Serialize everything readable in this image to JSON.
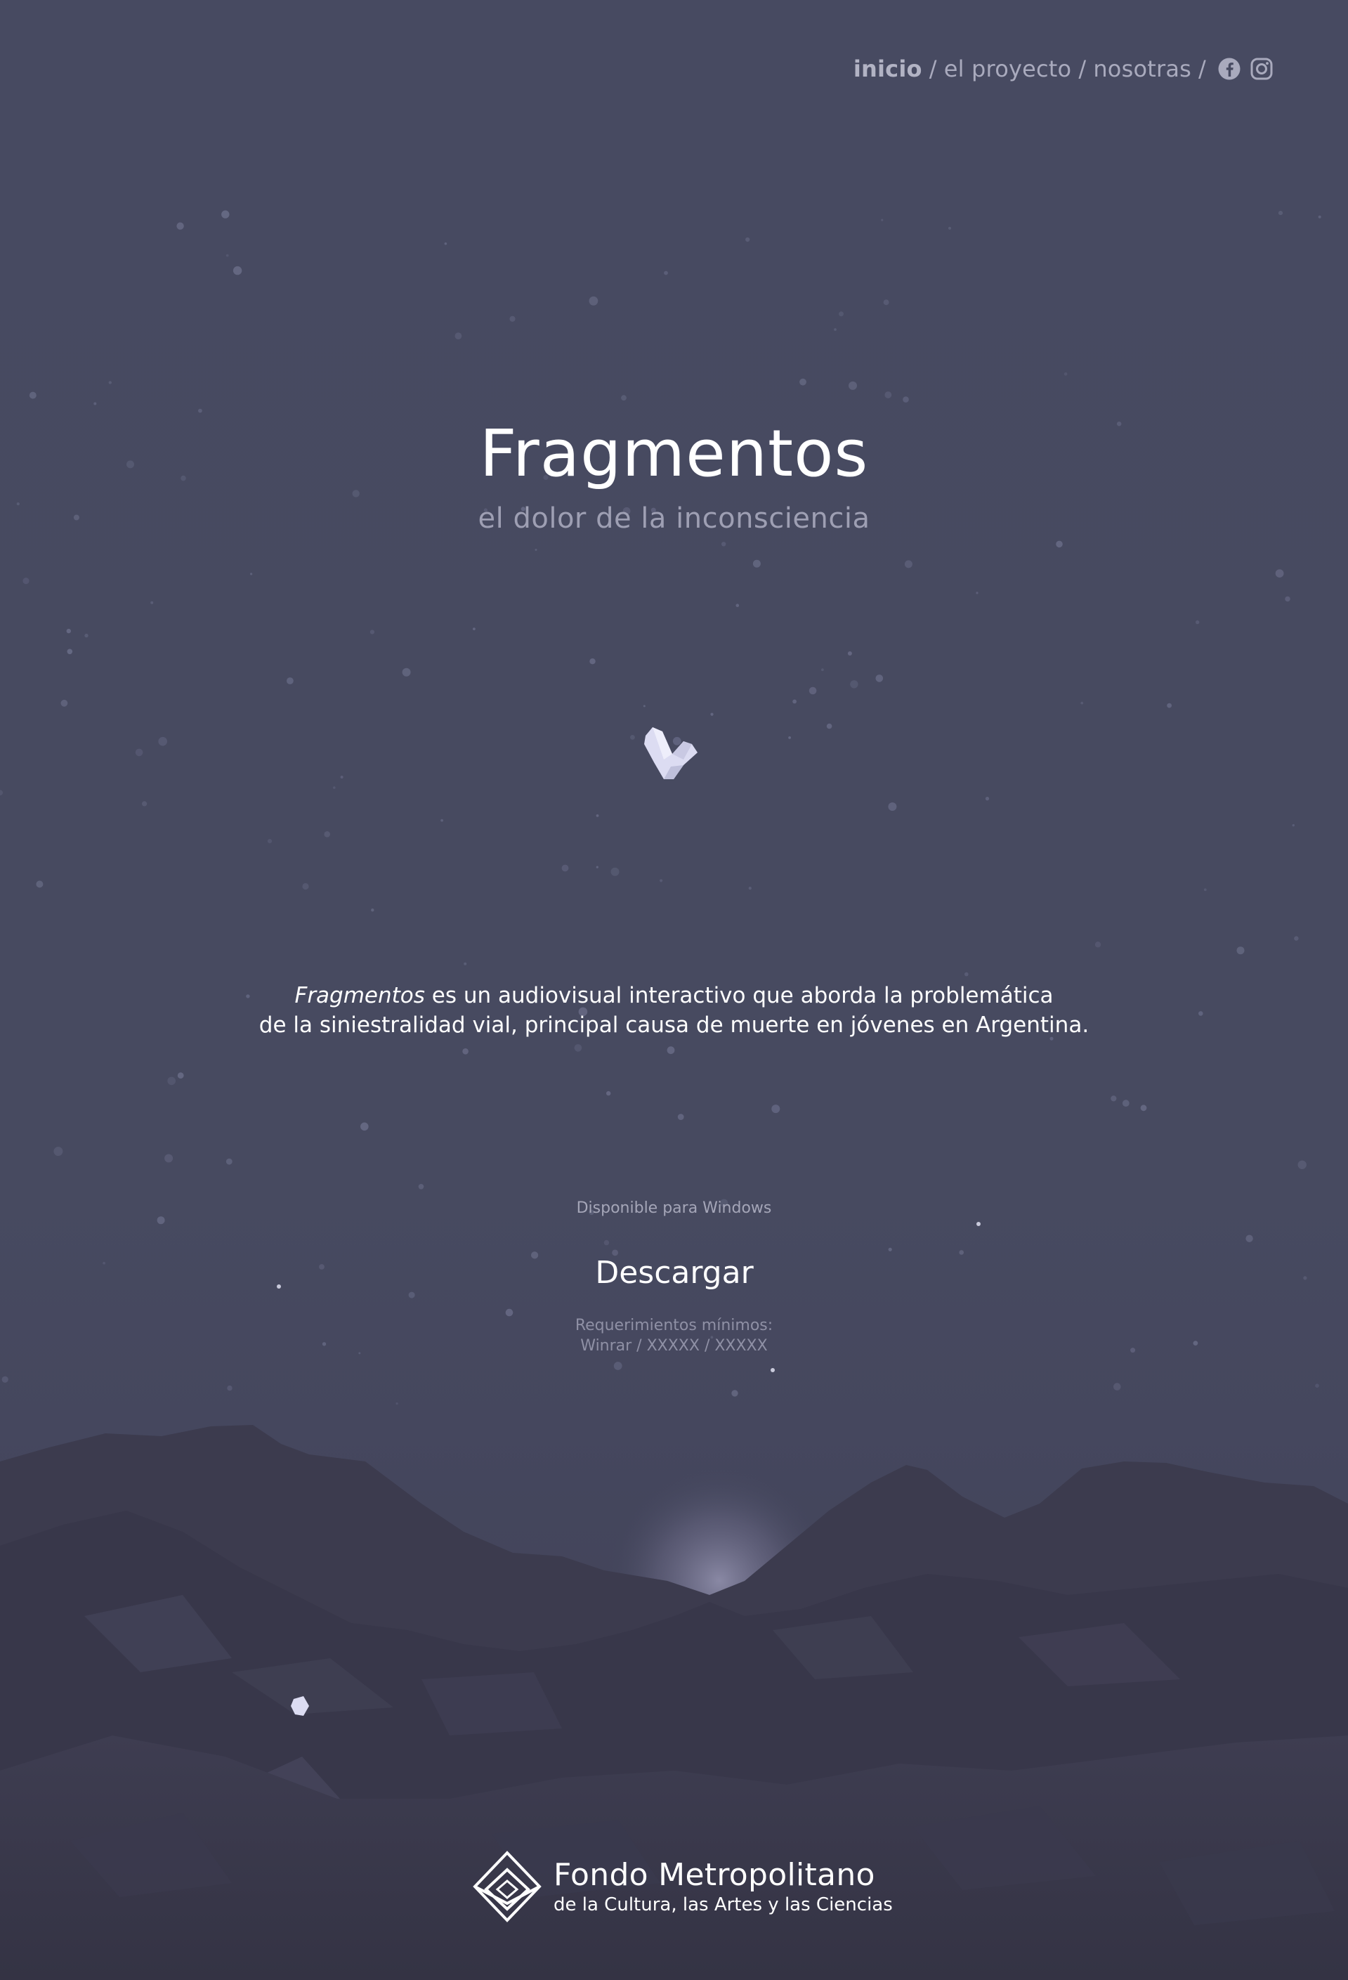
{
  "nav": {
    "items": [
      {
        "label": "inicio",
        "active": true
      },
      {
        "label": "el proyecto",
        "active": false
      },
      {
        "label": "nosotras",
        "active": false
      }
    ],
    "separator": "/",
    "social": [
      "facebook-icon",
      "instagram-icon"
    ]
  },
  "hero": {
    "title": "Fragmentos",
    "subtitle": "el dolor de la inconsciencia"
  },
  "description": {
    "title_italic": "Fragmentos",
    "line1_rest": " es un audiovisual interactivo que aborda la problemática",
    "line2": "de la siniestralidad vial, principal causa de muerte en jóvenes en Argentina."
  },
  "download": {
    "availability": "Disponible para Windows",
    "button_label": "Descargar",
    "requirements_title": "Requerimientos mínimos:",
    "requirements_value": "Winrar / XXXXX / XXXXX"
  },
  "footer": {
    "logo_name": "Fondo Metropolitano",
    "logo_tagline": "de la Cultura, las Artes y las Ciencias"
  },
  "colors": {
    "background": "#474a61",
    "text": "#ffffff",
    "muted": "#a9aabd",
    "mountains": "#3a394c",
    "crystal": "#dcdcf2"
  }
}
